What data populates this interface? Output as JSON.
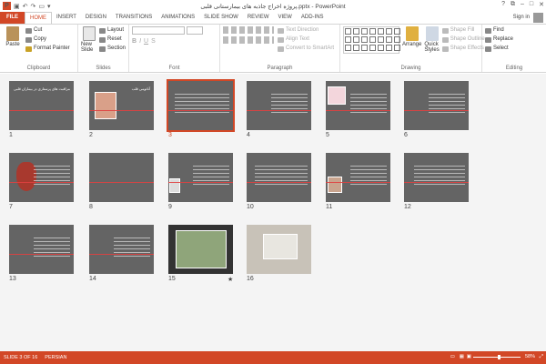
{
  "app": {
    "title": "پروژه اخراج جاذبه های بیمارستانی قلبی.pptx - PowerPoint"
  },
  "quick_access": {
    "icons": [
      "save-icon",
      "undo-icon",
      "redo-icon",
      "start-icon"
    ]
  },
  "tabs": [
    "FILE",
    "HOME",
    "INSERT",
    "DESIGN",
    "TRANSITIONS",
    "ANIMATIONS",
    "SLIDE SHOW",
    "REVIEW",
    "VIEW",
    "ADD-INS"
  ],
  "active_tab": "HOME",
  "account": {
    "sign_in": "Sign in"
  },
  "ribbon": {
    "clipboard": {
      "label": "Clipboard",
      "paste": "Paste",
      "cut": "Cut",
      "copy": "Copy",
      "format_painter": "Format Painter"
    },
    "slides": {
      "label": "Slides",
      "new_slide": "New Slide",
      "layout": "Layout",
      "reset": "Reset",
      "section": "Section"
    },
    "font": {
      "label": "Font"
    },
    "paragraph": {
      "label": "Paragraph",
      "text_direction": "Text Direction",
      "align_text": "Align Text",
      "convert": "Convert to SmartArt"
    },
    "drawing": {
      "label": "Drawing",
      "arrange": "Arrange",
      "quick_styles": "Quick Styles",
      "shape_fill": "Shape Fill",
      "shape_outline": "Shape Outline",
      "shape_effects": "Shape Effects"
    },
    "editing": {
      "label": "Editing",
      "find": "Find",
      "replace": "Replace",
      "select": "Select"
    }
  },
  "slides": [
    {
      "n": "1",
      "title": "مراقبت های پرستاری در بیماران قلبی"
    },
    {
      "n": "2",
      "title": "آناتومی قلب"
    },
    {
      "n": "3",
      "title": "",
      "selected": true
    },
    {
      "n": "4",
      "title": ""
    },
    {
      "n": "5",
      "title": ""
    },
    {
      "n": "6",
      "title": ""
    },
    {
      "n": "7",
      "title": ""
    },
    {
      "n": "8",
      "title": ""
    },
    {
      "n": "9",
      "title": ""
    },
    {
      "n": "10",
      "title": ""
    },
    {
      "n": "11",
      "title": ""
    },
    {
      "n": "12",
      "title": ""
    },
    {
      "n": "13",
      "title": ""
    },
    {
      "n": "14",
      "title": ""
    },
    {
      "n": "15",
      "title": ""
    },
    {
      "n": "16",
      "title": ""
    }
  ],
  "status": {
    "slide": "SLIDE 3 OF 16",
    "language": "PERSIAN",
    "zoom": "58%"
  },
  "colors": {
    "accent": "#d24726"
  }
}
